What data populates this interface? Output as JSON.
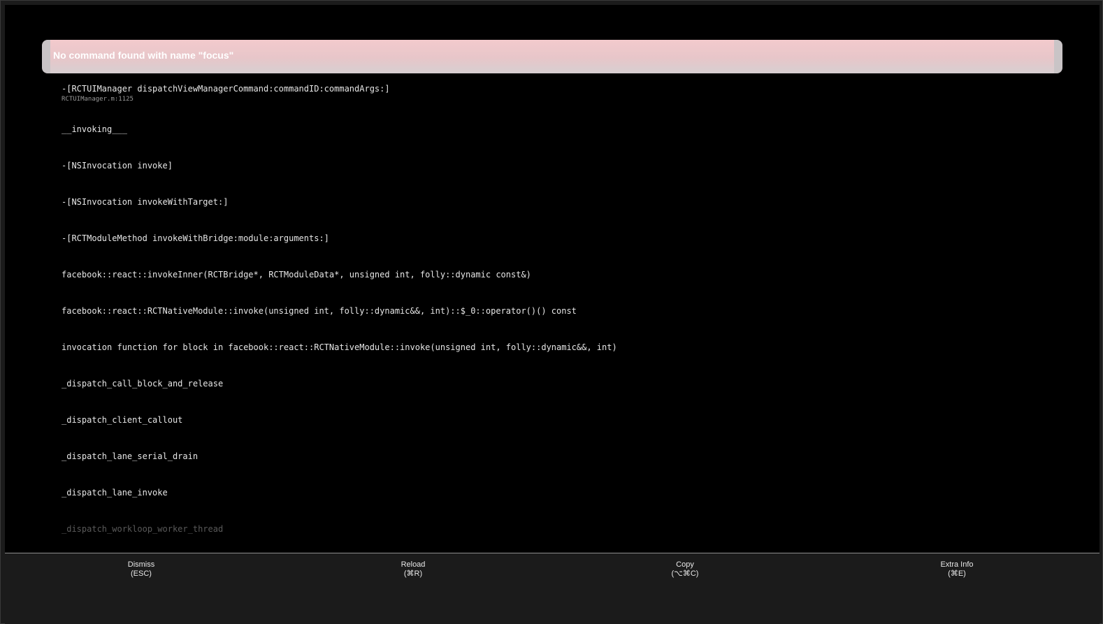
{
  "error": {
    "message": "No command found with name \"focus\""
  },
  "stack": [
    {
      "fn": "-[RCTUIManager dispatchViewManagerCommand:commandID:commandArgs:]",
      "loc": "RCTUIManager.m:1125"
    },
    {
      "fn": "__invoking___"
    },
    {
      "fn": "-[NSInvocation invoke]"
    },
    {
      "fn": "-[NSInvocation invokeWithTarget:]"
    },
    {
      "fn": "-[RCTModuleMethod invokeWithBridge:module:arguments:]"
    },
    {
      "fn": "facebook::react::invokeInner(RCTBridge*, RCTModuleData*, unsigned int, folly::dynamic const&)"
    },
    {
      "fn": "facebook::react::RCTNativeModule::invoke(unsigned int, folly::dynamic&&, int)::$_0::operator()() const"
    },
    {
      "fn": "invocation function for block in facebook::react::RCTNativeModule::invoke(unsigned int, folly::dynamic&&, int)"
    },
    {
      "fn": "_dispatch_call_block_and_release"
    },
    {
      "fn": "_dispatch_client_callout"
    },
    {
      "fn": "_dispatch_lane_serial_drain"
    },
    {
      "fn": "_dispatch_lane_invoke"
    },
    {
      "fn": "_dispatch_workloop_worker_thread"
    }
  ],
  "toolbar": {
    "dismiss": {
      "label": "Dismiss",
      "shortcut": "(ESC)"
    },
    "reload": {
      "label": "Reload",
      "shortcut": "(⌘R)"
    },
    "copy": {
      "label": "Copy",
      "shortcut": "(⌥⌘C)"
    },
    "extra": {
      "label": "Extra Info",
      "shortcut": "(⌘E)"
    }
  }
}
